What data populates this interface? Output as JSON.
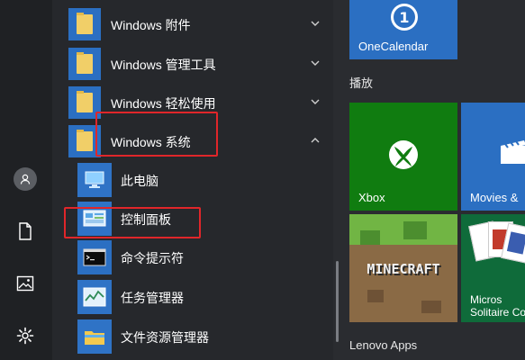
{
  "apps": {
    "folders": [
      {
        "label": "Windows 附件"
      },
      {
        "label": "Windows 管理工具"
      },
      {
        "label": "Windows 轻松使用"
      },
      {
        "label": "Windows 系统"
      }
    ],
    "system_items": [
      {
        "label": "此电脑"
      },
      {
        "label": "控制面板"
      },
      {
        "label": "命令提示符"
      },
      {
        "label": "任务管理器"
      },
      {
        "label": "文件资源管理器"
      }
    ]
  },
  "tiles": {
    "onecalendar": "OneCalendar",
    "group_play": "播放",
    "xbox": "Xbox",
    "movies": "Movies &",
    "minecraft_text": "MINECRAFT",
    "solitaire_line1": "Micros",
    "solitaire_line2": "Solitaire Co",
    "group_lenovo": "Lenovo Apps"
  },
  "colors": {
    "accent_blue": "#2b6fc2",
    "xbox_green": "#107c10",
    "highlight_red": "#e0262a",
    "folder_yellow": "#f1cf68"
  }
}
